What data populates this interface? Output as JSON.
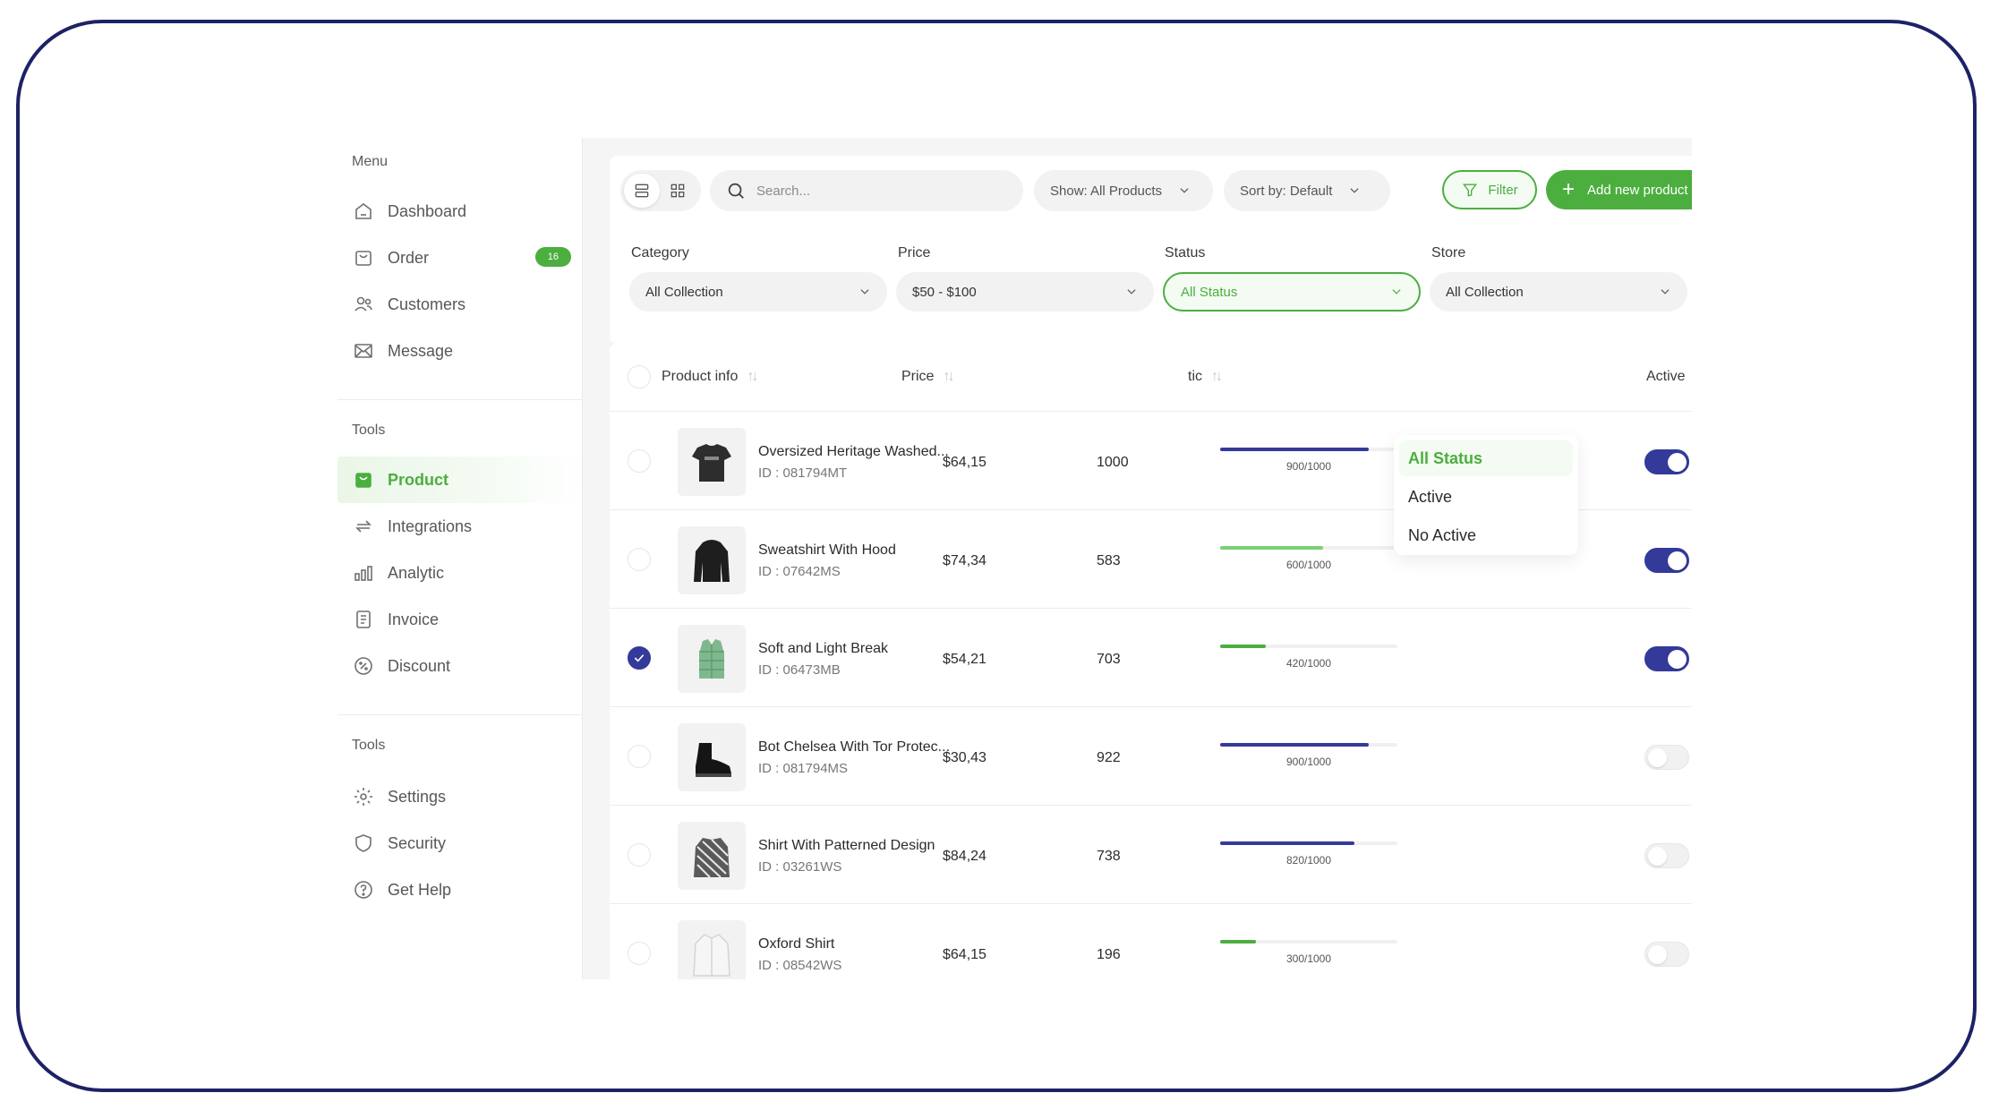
{
  "sidebar": {
    "menu_label": "Menu",
    "tools_label": "Tools",
    "tools2_label": "Tools",
    "items": [
      {
        "label": "Dashboard"
      },
      {
        "label": "Order",
        "badge": "16"
      },
      {
        "label": "Customers"
      },
      {
        "label": "Message"
      },
      {
        "label": "Product"
      },
      {
        "label": "Integrations"
      },
      {
        "label": "Analytic"
      },
      {
        "label": "Invoice"
      },
      {
        "label": "Discount"
      },
      {
        "label": "Settings"
      },
      {
        "label": "Security"
      },
      {
        "label": "Get Help"
      }
    ]
  },
  "toolbar": {
    "search_placeholder": "Search...",
    "show_label": "Show: All Products",
    "sort_label": "Sort by: Default",
    "filter_label": "Filter",
    "add_label": "Add new product"
  },
  "filters": {
    "category": {
      "label": "Category",
      "value": "All Collection"
    },
    "price": {
      "label": "Price",
      "value": "$50 - $100"
    },
    "status": {
      "label": "Status",
      "value": "All Status"
    },
    "store": {
      "label": "Store",
      "value": "All Collection"
    }
  },
  "status_dropdown": {
    "options": [
      "All Status",
      "Active",
      "No Active"
    ],
    "selected": "All Status"
  },
  "table": {
    "headers": {
      "product": "Product info",
      "price": "Price",
      "statistic": "tic",
      "active": "Active"
    },
    "rows": [
      {
        "name": "Oversized Heritage Washed...",
        "id": "ID : 081794MT",
        "price": "$64,15",
        "stock": "1000",
        "progress": "900/1000",
        "progress_pct": 0.84,
        "bar_color": "#343a9a",
        "active": true,
        "checked": false
      },
      {
        "name": "Sweatshirt With Hood",
        "id": "ID : 07642MS",
        "price": "$74,34",
        "stock": "583",
        "progress": "600/1000",
        "progress_pct": 0.58,
        "bar_color": "#7ad173",
        "active": true,
        "checked": false
      },
      {
        "name": "Soft and Light Break",
        "id": "ID : 06473MB",
        "price": "$54,21",
        "stock": "703",
        "progress": "420/1000",
        "progress_pct": 0.26,
        "bar_color": "#4cae3f",
        "active": true,
        "checked": true
      },
      {
        "name": "Bot Chelsea With Tor Protec...",
        "id": "ID : 081794MS",
        "price": "$30,43",
        "stock": "922",
        "progress": "900/1000",
        "progress_pct": 0.84,
        "bar_color": "#343a9a",
        "active": false,
        "checked": false
      },
      {
        "name": "Shirt With Patterned Design",
        "id": "ID : 03261WS",
        "price": "$84,24",
        "stock": "738",
        "progress": "820/1000",
        "progress_pct": 0.76,
        "bar_color": "#343a9a",
        "active": false,
        "checked": false
      },
      {
        "name": "Oxford Shirt",
        "id": "ID : 08542WS",
        "price": "$64,15",
        "stock": "196",
        "progress": "300/1000",
        "progress_pct": 0.2,
        "bar_color": "#4cae3f",
        "active": false,
        "checked": false
      }
    ]
  }
}
